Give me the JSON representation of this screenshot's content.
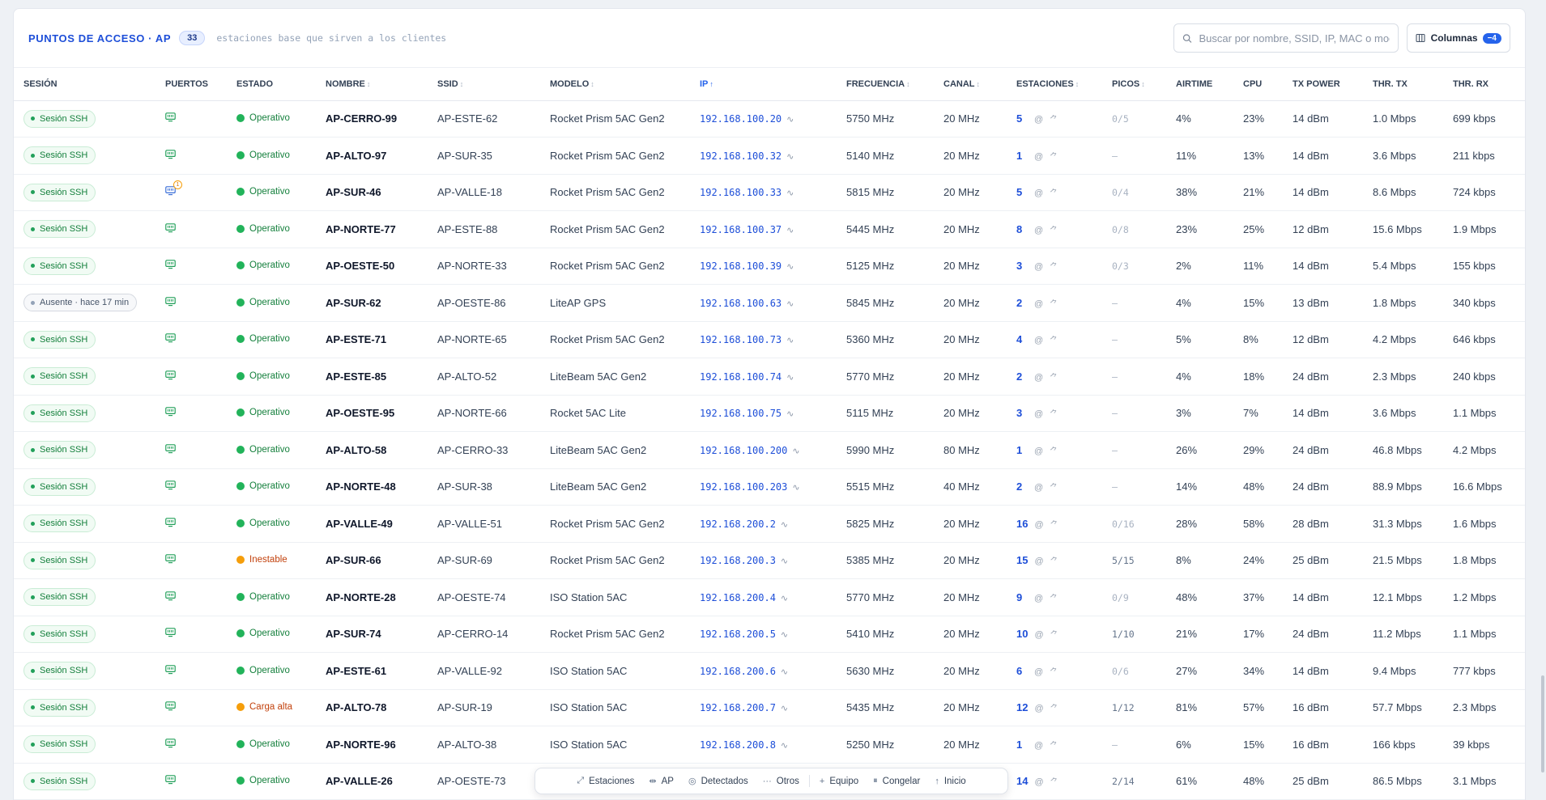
{
  "header": {
    "title": "PUNTOS DE ACCESO · AP",
    "count": "33",
    "subtitle": "estaciones base que sirven a los clientes",
    "search_placeholder": "Buscar por nombre, SSID, IP, MAC o modelo",
    "columns_label": "Columnas",
    "columns_badge": "−4"
  },
  "columns": [
    {
      "label": "SESIÓN",
      "sort": ""
    },
    {
      "label": "PUERTOS",
      "sort": ""
    },
    {
      "label": "ESTADO",
      "sort": ""
    },
    {
      "label": "NOMBRE",
      "sort": "↕"
    },
    {
      "label": "SSID",
      "sort": "↕"
    },
    {
      "label": "MODELO",
      "sort": "↕"
    },
    {
      "label": "IP",
      "sort": "↑"
    },
    {
      "label": "FRECUENCIA",
      "sort": "↕"
    },
    {
      "label": "CANAL",
      "sort": "↕"
    },
    {
      "label": "ESTACIONES",
      "sort": "↕"
    },
    {
      "label": "PICOS",
      "sort": "↕"
    },
    {
      "label": "AIRTIME",
      "sort": ""
    },
    {
      "label": "CPU",
      "sort": ""
    },
    {
      "label": "TX POWER",
      "sort": ""
    },
    {
      "label": "THR. TX",
      "sort": ""
    },
    {
      "label": "THR. RX",
      "sort": ""
    }
  ],
  "rows": [
    {
      "session": "Sesión SSH",
      "session_online": true,
      "port_alert": "",
      "status": "Operativo",
      "status_kind": "ok",
      "name": "AP-CERRO-99",
      "ssid": "AP-ESTE-62",
      "model": "Rocket Prism 5AC Gen2",
      "ip": "192.168.100.20",
      "freq": "5750 MHz",
      "channel": "20 MHz",
      "stations": "5",
      "peaks": "0/5",
      "peaks_dim": true,
      "airtime": "4%",
      "cpu": "23%",
      "txpower": "14 dBm",
      "thr_tx": "1.0 Mbps",
      "thr_rx": "699 kbps"
    },
    {
      "session": "Sesión SSH",
      "session_online": true,
      "port_alert": "",
      "status": "Operativo",
      "status_kind": "ok",
      "name": "AP-ALTO-97",
      "ssid": "AP-SUR-35",
      "model": "Rocket Prism 5AC Gen2",
      "ip": "192.168.100.32",
      "freq": "5140 MHz",
      "channel": "20 MHz",
      "stations": "1",
      "peaks": "–",
      "peaks_dim": true,
      "airtime": "11%",
      "cpu": "13%",
      "txpower": "14 dBm",
      "thr_tx": "3.6 Mbps",
      "thr_rx": "211 kbps"
    },
    {
      "session": "Sesión SSH",
      "session_online": true,
      "port_alert": "1",
      "status": "Operativo",
      "status_kind": "ok",
      "name": "AP-SUR-46",
      "ssid": "AP-VALLE-18",
      "model": "Rocket Prism 5AC Gen2",
      "ip": "192.168.100.33",
      "freq": "5815 MHz",
      "channel": "20 MHz",
      "stations": "5",
      "peaks": "0/4",
      "peaks_dim": true,
      "airtime": "38%",
      "cpu": "21%",
      "txpower": "14 dBm",
      "thr_tx": "8.6 Mbps",
      "thr_rx": "724 kbps"
    },
    {
      "session": "Sesión SSH",
      "session_online": true,
      "port_alert": "",
      "status": "Operativo",
      "status_kind": "ok",
      "name": "AP-NORTE-77",
      "ssid": "AP-ESTE-88",
      "model": "Rocket Prism 5AC Gen2",
      "ip": "192.168.100.37",
      "freq": "5445 MHz",
      "channel": "20 MHz",
      "stations": "8",
      "peaks": "0/8",
      "peaks_dim": true,
      "airtime": "23%",
      "cpu": "25%",
      "txpower": "12 dBm",
      "thr_tx": "15.6 Mbps",
      "thr_rx": "1.9 Mbps"
    },
    {
      "session": "Sesión SSH",
      "session_online": true,
      "port_alert": "",
      "status": "Operativo",
      "status_kind": "ok",
      "name": "AP-OESTE-50",
      "ssid": "AP-NORTE-33",
      "model": "Rocket Prism 5AC Gen2",
      "ip": "192.168.100.39",
      "freq": "5125 MHz",
      "channel": "20 MHz",
      "stations": "3",
      "peaks": "0/3",
      "peaks_dim": true,
      "airtime": "2%",
      "cpu": "11%",
      "txpower": "14 dBm",
      "thr_tx": "5.4 Mbps",
      "thr_rx": "155 kbps"
    },
    {
      "session": "Ausente · hace 17 min",
      "session_online": false,
      "port_alert": "",
      "status": "Operativo",
      "status_kind": "ok",
      "name": "AP-SUR-62",
      "ssid": "AP-OESTE-86",
      "model": "LiteAP GPS",
      "ip": "192.168.100.63",
      "freq": "5845 MHz",
      "channel": "20 MHz",
      "stations": "2",
      "peaks": "–",
      "peaks_dim": true,
      "airtime": "4%",
      "cpu": "15%",
      "txpower": "13 dBm",
      "thr_tx": "1.8 Mbps",
      "thr_rx": "340 kbps"
    },
    {
      "session": "Sesión SSH",
      "session_online": true,
      "port_alert": "",
      "status": "Operativo",
      "status_kind": "ok",
      "name": "AP-ESTE-71",
      "ssid": "AP-NORTE-65",
      "model": "Rocket Prism 5AC Gen2",
      "ip": "192.168.100.73",
      "freq": "5360 MHz",
      "channel": "20 MHz",
      "stations": "4",
      "peaks": "–",
      "peaks_dim": true,
      "airtime": "5%",
      "cpu": "8%",
      "txpower": "12 dBm",
      "thr_tx": "4.2 Mbps",
      "thr_rx": "646 kbps"
    },
    {
      "session": "Sesión SSH",
      "session_online": true,
      "port_alert": "",
      "status": "Operativo",
      "status_kind": "ok",
      "name": "AP-ESTE-85",
      "ssid": "AP-ALTO-52",
      "model": "LiteBeam 5AC Gen2",
      "ip": "192.168.100.74",
      "freq": "5770 MHz",
      "channel": "20 MHz",
      "stations": "2",
      "peaks": "–",
      "peaks_dim": true,
      "airtime": "4%",
      "cpu": "18%",
      "txpower": "24 dBm",
      "thr_tx": "2.3 Mbps",
      "thr_rx": "240 kbps"
    },
    {
      "session": "Sesión SSH",
      "session_online": true,
      "port_alert": "",
      "status": "Operativo",
      "status_kind": "ok",
      "name": "AP-OESTE-95",
      "ssid": "AP-NORTE-66",
      "model": "Rocket 5AC Lite",
      "ip": "192.168.100.75",
      "freq": "5115 MHz",
      "channel": "20 MHz",
      "stations": "3",
      "peaks": "–",
      "peaks_dim": true,
      "airtime": "3%",
      "cpu": "7%",
      "txpower": "14 dBm",
      "thr_tx": "3.6 Mbps",
      "thr_rx": "1.1 Mbps"
    },
    {
      "session": "Sesión SSH",
      "session_online": true,
      "port_alert": "",
      "status": "Operativo",
      "status_kind": "ok",
      "name": "AP-ALTO-58",
      "ssid": "AP-CERRO-33",
      "model": "LiteBeam 5AC Gen2",
      "ip": "192.168.100.200",
      "freq": "5990 MHz",
      "channel": "80 MHz",
      "stations": "1",
      "peaks": "–",
      "peaks_dim": true,
      "airtime": "26%",
      "cpu": "29%",
      "txpower": "24 dBm",
      "thr_tx": "46.8 Mbps",
      "thr_rx": "4.2 Mbps"
    },
    {
      "session": "Sesión SSH",
      "session_online": true,
      "port_alert": "",
      "status": "Operativo",
      "status_kind": "ok",
      "name": "AP-NORTE-48",
      "ssid": "AP-SUR-38",
      "model": "LiteBeam 5AC Gen2",
      "ip": "192.168.100.203",
      "freq": "5515 MHz",
      "channel": "40 MHz",
      "stations": "2",
      "peaks": "–",
      "peaks_dim": true,
      "airtime": "14%",
      "cpu": "48%",
      "txpower": "24 dBm",
      "thr_tx": "88.9 Mbps",
      "thr_rx": "16.6 Mbps"
    },
    {
      "session": "Sesión SSH",
      "session_online": true,
      "port_alert": "",
      "status": "Operativo",
      "status_kind": "ok",
      "name": "AP-VALLE-49",
      "ssid": "AP-VALLE-51",
      "model": "Rocket Prism 5AC Gen2",
      "ip": "192.168.200.2",
      "freq": "5825 MHz",
      "channel": "20 MHz",
      "stations": "16",
      "peaks": "0/16",
      "peaks_dim": true,
      "airtime": "28%",
      "cpu": "58%",
      "txpower": "28 dBm",
      "thr_tx": "31.3 Mbps",
      "thr_rx": "1.6 Mbps"
    },
    {
      "session": "Sesión SSH",
      "session_online": true,
      "port_alert": "",
      "status": "Inestable",
      "status_kind": "warn",
      "name": "AP-SUR-66",
      "ssid": "AP-SUR-69",
      "model": "Rocket Prism 5AC Gen2",
      "ip": "192.168.200.3",
      "freq": "5385 MHz",
      "channel": "20 MHz",
      "stations": "15",
      "peaks": "5/15",
      "peaks_dim": false,
      "airtime": "8%",
      "cpu": "24%",
      "txpower": "25 dBm",
      "thr_tx": "21.5 Mbps",
      "thr_rx": "1.8 Mbps"
    },
    {
      "session": "Sesión SSH",
      "session_online": true,
      "port_alert": "",
      "status": "Operativo",
      "status_kind": "ok",
      "name": "AP-NORTE-28",
      "ssid": "AP-OESTE-74",
      "model": "ISO Station 5AC",
      "ip": "192.168.200.4",
      "freq": "5770 MHz",
      "channel": "20 MHz",
      "stations": "9",
      "peaks": "0/9",
      "peaks_dim": true,
      "airtime": "48%",
      "cpu": "37%",
      "txpower": "14 dBm",
      "thr_tx": "12.1 Mbps",
      "thr_rx": "1.2 Mbps"
    },
    {
      "session": "Sesión SSH",
      "session_online": true,
      "port_alert": "",
      "status": "Operativo",
      "status_kind": "ok",
      "name": "AP-SUR-74",
      "ssid": "AP-CERRO-14",
      "model": "Rocket Prism 5AC Gen2",
      "ip": "192.168.200.5",
      "freq": "5410 MHz",
      "channel": "20 MHz",
      "stations": "10",
      "peaks": "1/10",
      "peaks_dim": false,
      "airtime": "21%",
      "cpu": "17%",
      "txpower": "24 dBm",
      "thr_tx": "11.2 Mbps",
      "thr_rx": "1.1 Mbps"
    },
    {
      "session": "Sesión SSH",
      "session_online": true,
      "port_alert": "",
      "status": "Operativo",
      "status_kind": "ok",
      "name": "AP-ESTE-61",
      "ssid": "AP-VALLE-92",
      "model": "ISO Station 5AC",
      "ip": "192.168.200.6",
      "freq": "5630 MHz",
      "channel": "20 MHz",
      "stations": "6",
      "peaks": "0/6",
      "peaks_dim": true,
      "airtime": "27%",
      "cpu": "34%",
      "txpower": "14 dBm",
      "thr_tx": "9.4 Mbps",
      "thr_rx": "777 kbps"
    },
    {
      "session": "Sesión SSH",
      "session_online": true,
      "port_alert": "",
      "status": "Carga alta",
      "status_kind": "warn",
      "name": "AP-ALTO-78",
      "ssid": "AP-SUR-19",
      "model": "ISO Station 5AC",
      "ip": "192.168.200.7",
      "freq": "5435 MHz",
      "channel": "20 MHz",
      "stations": "12",
      "peaks": "1/12",
      "peaks_dim": false,
      "airtime": "81%",
      "cpu": "57%",
      "txpower": "16 dBm",
      "thr_tx": "57.7 Mbps",
      "thr_rx": "2.3 Mbps"
    },
    {
      "session": "Sesión SSH",
      "session_online": true,
      "port_alert": "",
      "status": "Operativo",
      "status_kind": "ok",
      "name": "AP-NORTE-96",
      "ssid": "AP-ALTO-38",
      "model": "ISO Station 5AC",
      "ip": "192.168.200.8",
      "freq": "5250 MHz",
      "channel": "20 MHz",
      "stations": "1",
      "peaks": "–",
      "peaks_dim": true,
      "airtime": "6%",
      "cpu": "15%",
      "txpower": "16 dBm",
      "thr_tx": "166 kbps",
      "thr_rx": "39 kbps"
    },
    {
      "session": "Sesión SSH",
      "session_online": true,
      "port_alert": "",
      "status": "Operativo",
      "status_kind": "ok",
      "name": "AP-VALLE-26",
      "ssid": "AP-OESTE-73",
      "model": "",
      "ip": "",
      "freq": "",
      "channel": "",
      "stations": "14",
      "peaks": "2/14",
      "peaks_dim": false,
      "airtime": "61%",
      "cpu": "48%",
      "txpower": "25 dBm",
      "thr_tx": "86.5 Mbps",
      "thr_rx": "3.1 Mbps"
    }
  ],
  "bottom_bar": [
    {
      "name": "estaciones",
      "icon": "⤢",
      "label": "Estaciones"
    },
    {
      "name": "ap",
      "icon": "⇹",
      "label": "AP"
    },
    {
      "name": "detectados",
      "icon": "◎",
      "label": "Detectados"
    },
    {
      "name": "otros",
      "icon": "···",
      "label": "Otros"
    },
    {
      "name": "equipo",
      "icon": "+",
      "label": "Equipo"
    },
    {
      "name": "congelar",
      "icon": "⏸",
      "label": "Congelar"
    },
    {
      "name": "inicio",
      "icon": "↑",
      "label": "Inicio"
    }
  ],
  "colors": {
    "accent": "#2563eb",
    "ok": "#22b35a",
    "warn": "#f59e0b"
  }
}
